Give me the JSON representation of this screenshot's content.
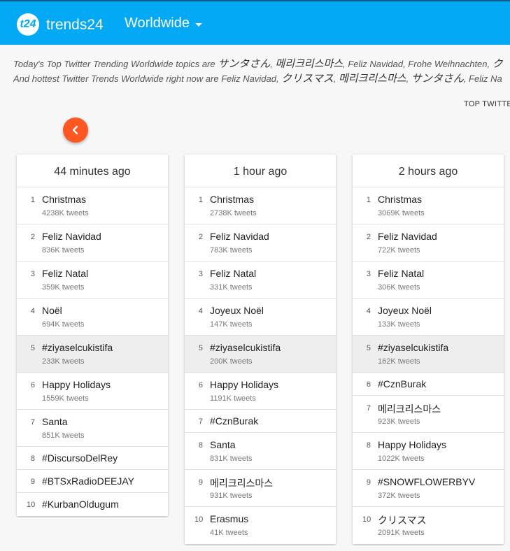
{
  "header": {
    "logo_badge": "t24",
    "logo_text": "trends24",
    "region": "Worldwide"
  },
  "summary": {
    "line1_prefix": "Today's Top Twitter Trending Worldwide topics are ",
    "line1_t1": "サンタさん",
    "line1_sep1": ", ",
    "line1_t2": "메리크리스마스",
    "line1_rest": ", Feliz Navidad, Frohe Weihnachten, ",
    "line1_t3": "ク",
    "line2_prefix": "And hottest Twitter Trends Worldwide right now are Feliz Navidad, ",
    "line2_t1": "クリスマス",
    "line2_sep1": ", ",
    "line2_t2": "메리크리스마스",
    "line2_sep2": ", ",
    "line2_t3": "サンタさん",
    "line2_rest": ", Feliz Na"
  },
  "top_link": "TOP TWITTE",
  "columns": [
    {
      "title": "44 minutes ago",
      "trends": [
        {
          "rank": "1",
          "name": "Christmas",
          "tweets": "4238K tweets"
        },
        {
          "rank": "2",
          "name": "Feliz Navidad",
          "tweets": "836K tweets"
        },
        {
          "rank": "3",
          "name": "Feliz Natal",
          "tweets": "359K tweets"
        },
        {
          "rank": "4",
          "name": "Noël",
          "tweets": "694K tweets"
        },
        {
          "rank": "5",
          "name": "#ziyaselcukistifa",
          "tweets": "233K tweets",
          "highlight": true
        },
        {
          "rank": "6",
          "name": "Happy Holidays",
          "tweets": "1559K tweets"
        },
        {
          "rank": "7",
          "name": "Santa",
          "tweets": "851K tweets"
        },
        {
          "rank": "8",
          "name": "#DiscursoDelRey",
          "tweets": ""
        },
        {
          "rank": "9",
          "name": "#BTSxRadioDEEJAY",
          "tweets": ""
        },
        {
          "rank": "10",
          "name": "#KurbanOldugum",
          "tweets": ""
        }
      ]
    },
    {
      "title": "1 hour ago",
      "trends": [
        {
          "rank": "1",
          "name": "Christmas",
          "tweets": "2738K tweets"
        },
        {
          "rank": "2",
          "name": "Feliz Navidad",
          "tweets": "783K tweets"
        },
        {
          "rank": "3",
          "name": "Feliz Natal",
          "tweets": "331K tweets"
        },
        {
          "rank": "4",
          "name": "Joyeux Noël",
          "tweets": "147K tweets"
        },
        {
          "rank": "5",
          "name": "#ziyaselcukistifa",
          "tweets": "200K tweets",
          "highlight": true
        },
        {
          "rank": "6",
          "name": "Happy Holidays",
          "tweets": "1191K tweets"
        },
        {
          "rank": "7",
          "name": "#CznBurak",
          "tweets": ""
        },
        {
          "rank": "8",
          "name": "Santa",
          "tweets": "831K tweets"
        },
        {
          "rank": "9",
          "name": "메리크리스마스",
          "tweets": "931K tweets"
        },
        {
          "rank": "10",
          "name": "Erasmus",
          "tweets": "41K tweets"
        }
      ]
    },
    {
      "title": "2 hours ago",
      "trends": [
        {
          "rank": "1",
          "name": "Christmas",
          "tweets": "3069K tweets"
        },
        {
          "rank": "2",
          "name": "Feliz Navidad",
          "tweets": "722K tweets"
        },
        {
          "rank": "3",
          "name": "Feliz Natal",
          "tweets": "306K tweets"
        },
        {
          "rank": "4",
          "name": "Joyeux Noël",
          "tweets": "133K tweets"
        },
        {
          "rank": "5",
          "name": "#ziyaselcukistifa",
          "tweets": "162K tweets",
          "highlight": true
        },
        {
          "rank": "6",
          "name": "#CznBurak",
          "tweets": ""
        },
        {
          "rank": "7",
          "name": "메리크리스마스",
          "tweets": "923K tweets"
        },
        {
          "rank": "8",
          "name": "Happy Holidays",
          "tweets": "1022K tweets"
        },
        {
          "rank": "9",
          "name": "#SNOWFLOWERBYV",
          "tweets": "372K tweets"
        },
        {
          "rank": "10",
          "name": "クリスマス",
          "tweets": "2091K tweets"
        }
      ]
    }
  ],
  "colors": {
    "header_bg": "#03a9f4",
    "back_button": "#ff5722",
    "highlight_row": "#eeeeee"
  },
  "icons": {
    "back": "chevron-left-icon",
    "dropdown": "caret-down-icon"
  }
}
